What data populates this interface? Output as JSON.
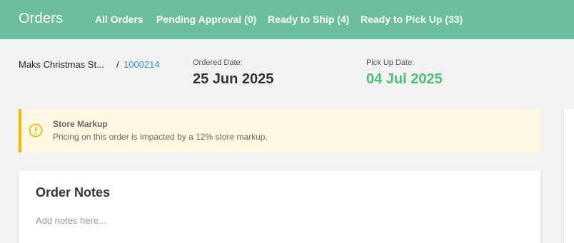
{
  "header": {
    "title": "Orders",
    "nav": [
      {
        "label": "All Orders"
      },
      {
        "label": "Pending Approval (0)"
      },
      {
        "label": "Ready to Ship (4)"
      },
      {
        "label": "Ready to Pick Up (33)"
      }
    ]
  },
  "order": {
    "store_name": "Maks Christmas St...",
    "separator": "/",
    "order_id": "1000214",
    "ordered_date_label": "Ordered Date:",
    "ordered_date": "25 Jun 2025",
    "pickup_date_label": "Pick Up Date:",
    "pickup_date": "04 Jul 2025"
  },
  "alert": {
    "icon": "exclamation-circle-icon",
    "title": "Store Markup",
    "text": "Pricing on this order is impacted by a 12% store markup."
  },
  "notes": {
    "title": "Order Notes",
    "placeholder": "Add notes here..."
  },
  "colors": {
    "header_bg": "#6bbf9e",
    "link": "#2a8fd6",
    "pickup_date": "#4cbf7a",
    "alert_accent": "#f2b705",
    "alert_bg": "#fff8e3"
  }
}
